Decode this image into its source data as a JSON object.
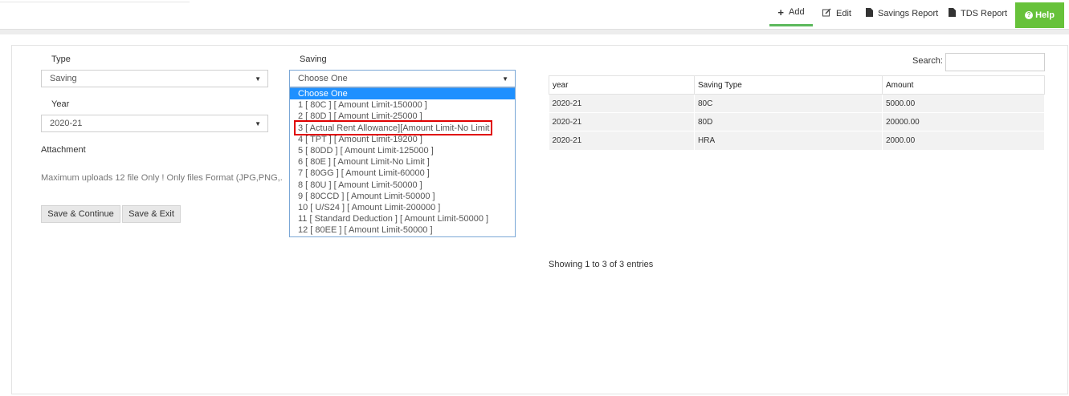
{
  "nav": {
    "add": "Add",
    "edit": "Edit",
    "savings_report": "Savings Report",
    "tds_report": "TDS Report",
    "help": "Help"
  },
  "form": {
    "type_label": "Type",
    "type_value": "Saving",
    "saving_label": "Saving",
    "saving_value": "Choose One",
    "year_label": "Year",
    "year_value": "2020-21",
    "attachment_label": "Attachment",
    "upload_note": "Maximum uploads 12 file Only ! Only files Format (JPG,PNG,.",
    "save_continue": "Save & Continue",
    "save_exit": "Save & Exit"
  },
  "saving_options": [
    "Choose One",
    "1 [ 80C ] [ Amount Limit-150000 ]",
    "2 [ 80D ] [ Amount Limit-25000 ]",
    "3 [ Actual Rent Allowance][Amount Limit-No Limit",
    "4 [ TPT ] [ Amount Limit-19200 ]",
    "5 [ 80DD ] [ Amount Limit-125000 ]",
    "6 [ 80E ] [ Amount Limit-No Limit ]",
    "7 [ 80GG ] [ Amount Limit-60000 ]",
    "8 [ 80U ] [ Amount Limit-50000 ]",
    "9 [ 80CCD ] [ Amount Limit-50000 ]",
    "10 [ U/S24 ] [ Amount Limit-200000 ]",
    "11 [ Standard Deduction ] [ Amount Limit-50000 ]",
    "12 [ 80EE ] [ Amount Limit-50000 ]"
  ],
  "table": {
    "search_label": "Search:",
    "headers": [
      "year",
      "Saving Type",
      "Amount"
    ],
    "rows": [
      [
        "2020-21",
        "80C",
        "5000.00"
      ],
      [
        "2020-21",
        "80D",
        "20000.00"
      ],
      [
        "2020-21",
        "HRA",
        "2000.00"
      ]
    ],
    "info": "Showing 1 to 3 of 3 entries"
  },
  "colors": {
    "accent_green": "#67c23a",
    "selected_blue": "#1e90ff",
    "highlight_red": "#e00000"
  }
}
